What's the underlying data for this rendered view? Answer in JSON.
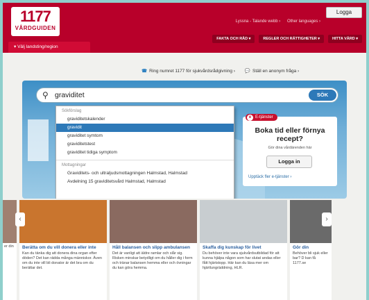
{
  "header": {
    "logo_number": "1177",
    "logo_name": "VÅRDGUIDEN",
    "login": "Logga",
    "toplinks": [
      "Lyssna - Talande webb ›",
      "Other languages ›"
    ],
    "nav": [
      "FAKTA OCH RÅD ▾",
      "REGLER OCH RÄTTIGHETER ▾",
      "HITTA VÅRD ▾"
    ],
    "region": "▾ Välj landsting/region"
  },
  "help": {
    "phone": "Ring numret 1177 för sjukvårdsrådgivning ›",
    "anon": "Ställ en anonym fråga ›"
  },
  "search": {
    "query": "graviditet",
    "button": "SÖK"
  },
  "dropdown": {
    "suggest_head": "Sökförslag",
    "suggestions": [
      "graviditetskalender",
      "gravidit",
      "graviditet symtom",
      "graviditetstest",
      "graviditet tidiga symptom"
    ],
    "selected_index": 1,
    "clinics_head": "Mottagningar",
    "clinics": [
      "Graviditets- och ultraljudsmottagningen Halmstad, Halmstad",
      "Avdelning 15 graviditetsvård Halmstad, Halmstad"
    ]
  },
  "eservice": {
    "badge": "E-tjänster",
    "title": "Boka tid eller förnya recept?",
    "subtitle": "Gör dina vårdärenden här",
    "button": "Logga in",
    "link": "Upptäck fler e-tjänster ›"
  },
  "cards": [
    {
      "title": "Berätta om du vill donera eller inte",
      "text": "Kan du tänka dig att donera dina organ efter döden? Det kan rädda många människor. Även om du inte vill bli donator är det bra om du berättar det.",
      "img_color": "#c9752e"
    },
    {
      "title": "Håll balansen och slipp ambulansen",
      "text": "Det är vanligt att äldre ramlar och slår sig. Risken minskar betydligt om du håller dig i form och tränar balansen hemma eller och övningar du kan göra hemma.",
      "img_color": "#8a6a60"
    },
    {
      "title": "Skaffa dig kunskap för livet",
      "text": "Du behöver inte vara sjukvårdsutbildad för att kunna hjälpa någon som har slutat andas eller fått hjärtstopp. Här kan du läsa mer om hjärtlungräddning, HLR.",
      "img_color": "#c8cdd0"
    },
    {
      "title": "Gör din",
      "text": "Behöver bli sjuk eller bar? D kan få 1177.se",
      "img_color": "#6a6a6a"
    }
  ],
  "edge_text": "er din"
}
